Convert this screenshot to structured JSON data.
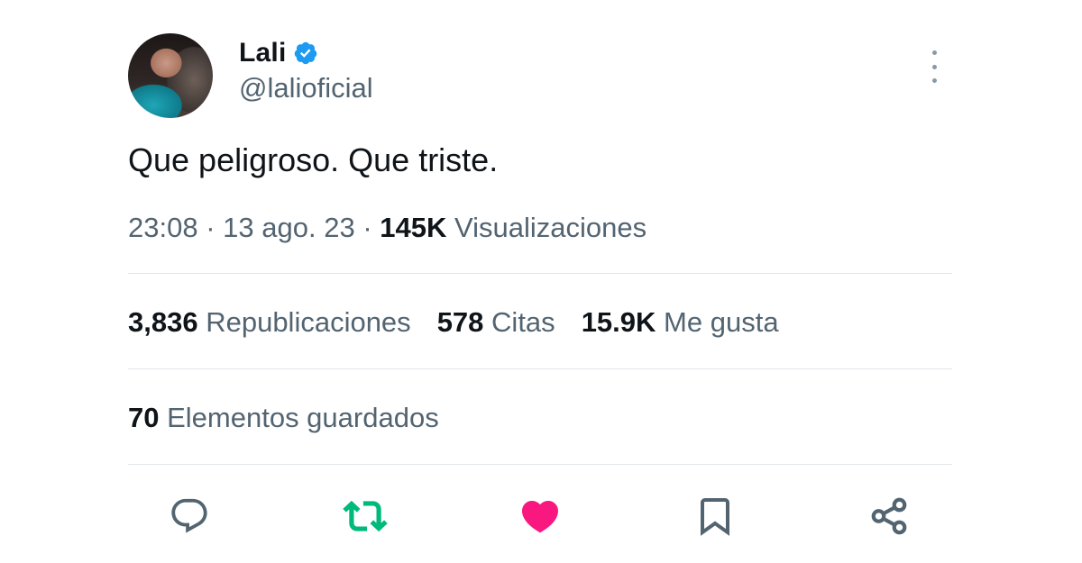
{
  "user": {
    "name": "Lali",
    "handle": "@lalioficial"
  },
  "tweet": {
    "text": "Que peligroso. Que triste."
  },
  "meta": {
    "time": "23:08",
    "separator": "·",
    "date": "13 ago. 23",
    "views_count": "145K",
    "views_label": "Visualizaciones"
  },
  "stats": {
    "reposts_count": "3,836",
    "reposts_label": "Republicaciones",
    "quotes_count": "578",
    "quotes_label": "Citas",
    "likes_count": "15.9K",
    "likes_label": "Me gusta"
  },
  "bookmarks": {
    "count": "70",
    "label": "Elementos guardados"
  },
  "icons": {
    "verified": "verified-badge-icon",
    "more": "more-vertical-icon",
    "reply": "reply-icon",
    "repost": "repost-icon",
    "like": "heart-icon",
    "bookmark": "bookmark-icon",
    "share": "share-icon"
  },
  "colors": {
    "verified_blue": "#1d9bf0",
    "repost_active": "#00ba7c",
    "like_active": "#f91880",
    "icon_gray": "#536471"
  }
}
